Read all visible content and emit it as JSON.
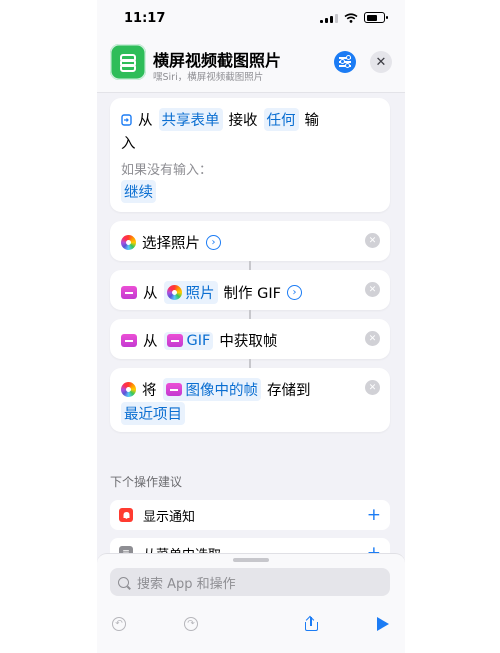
{
  "status_bar": {
    "time": "11:17"
  },
  "header": {
    "title": "横屏视频截图照片",
    "subtitle": "嘿Siri，横屏视频截图照片",
    "settings_icon": "sliders-icon",
    "close_glyph": "✕"
  },
  "actions": {
    "receive": {
      "from": "从",
      "source": "共享表单",
      "verb": "接收",
      "type": "任何",
      "input_1": "输",
      "input_2": "入",
      "no_input_label": "如果没有输入：",
      "no_input_value": "继续"
    },
    "select_photos": {
      "label": "选择照片"
    },
    "make_gif": {
      "from": "从",
      "source": "照片",
      "verb": "制作 GIF"
    },
    "get_frames": {
      "from": "从",
      "source": "GIF",
      "verb": "中获取帧"
    },
    "save": {
      "verb": "将",
      "source": "图像中的帧",
      "verb2": "存储到",
      "album": "最近项目"
    },
    "remove_glyph": "✕",
    "chevron_glyph": "›"
  },
  "suggestions": {
    "title": "下个操作建议",
    "items": [
      {
        "label": "显示通知",
        "icon": "bell-icon",
        "color": "#ff3b30"
      },
      {
        "label": "从菜单中选取",
        "icon": "menu-icon",
        "color": "#8e8e93"
      }
    ],
    "add_glyph": "+"
  },
  "bottom_sheet": {
    "search_placeholder": "搜索 App 和操作"
  },
  "colors": {
    "accent": "#1c7cf4",
    "app_icon": "#2ebd59",
    "background": "#f2f2f7"
  }
}
